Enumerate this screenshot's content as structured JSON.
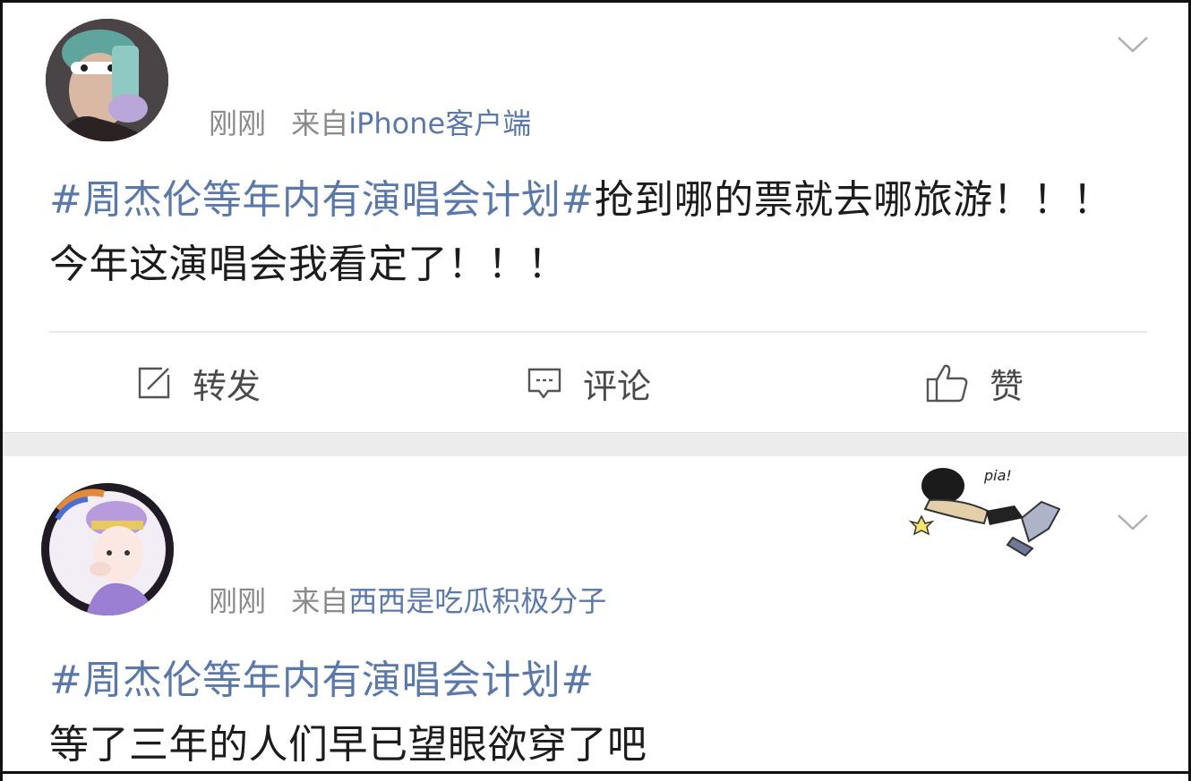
{
  "posts": [
    {
      "time": "刚刚",
      "from_label": "来自",
      "source": "iPhone客户端",
      "topic": "#周杰伦等年内有演唱会计划#",
      "text": "抢到哪的票就去哪旅游！！！ 今年这演唱会我看定了！！！",
      "actions": {
        "repost": "转发",
        "comment": "评论",
        "like": "赞"
      }
    },
    {
      "time": "刚刚",
      "from_label": "来自",
      "source": "西西是吃瓜积极分子",
      "topic": "#周杰伦等年内有演唱会计划#",
      "text": "等了三年的人们早已望眼欲穿了吧",
      "sticker_text": "pia!"
    }
  ],
  "colors": {
    "topic": "#5a78a8",
    "meta": "#8a8a8a",
    "text": "#1c1c1c",
    "separator": "#ececec"
  },
  "icons": [
    "chevron-down-icon",
    "repost-icon",
    "comment-icon",
    "like-icon"
  ]
}
